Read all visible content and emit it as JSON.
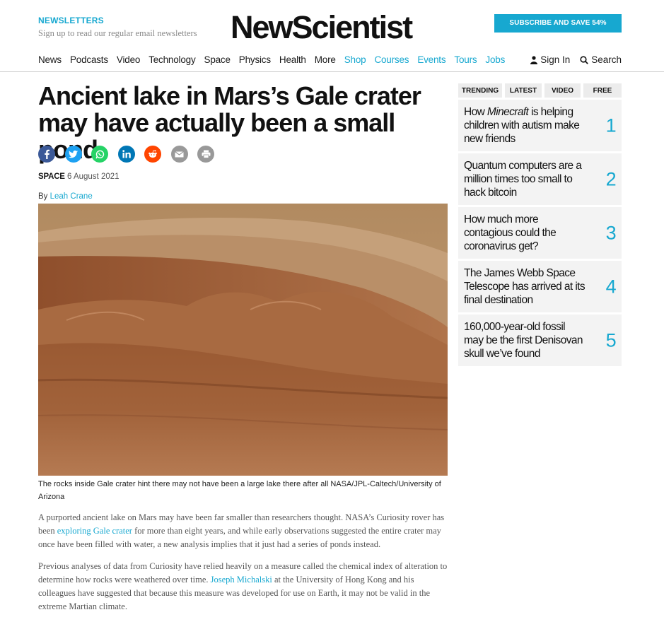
{
  "header": {
    "newsletters_title": "NEWSLETTERS",
    "newsletters_sub": "Sign up to read our regular email newsletters",
    "logo": "NewScientist",
    "subscribe": "SUBSCRIBE AND SAVE 54%"
  },
  "nav": {
    "items": [
      "News",
      "Podcasts",
      "Video",
      "Technology",
      "Space",
      "Physics",
      "Health",
      "More",
      "Shop",
      "Courses",
      "Events",
      "Tours",
      "Jobs"
    ],
    "sign_in": "Sign In",
    "search": "Search"
  },
  "article": {
    "headline": "Ancient lake in Mars’s Gale crater may have actually been a small pond",
    "section": "SPACE",
    "date": "6 August 2021",
    "by": "By",
    "author": "Leah Crane",
    "caption": "The rocks inside Gale crater hint there may not have been a large lake there after all NASA/JPL-Caltech/University of Arizona",
    "p1_a": "A purported ancient lake on Mars may have been far smaller than researchers thought. NASA’s Curiosity rover has been ",
    "p1_link": "exploring Gale crater",
    "p1_b": " for more than eight years, and while early observations suggested the entire crater may once have been filled with water, a new analysis implies that it just had a series of ponds instead.",
    "p2_a": "Previous analyses of data from Curiosity have relied heavily on a measure called the chemical index of alteration to determine how rocks were weathered over time. ",
    "p2_link": "Joseph Michalski",
    "p2_b": " at the University of Hong Kong and his colleagues have suggested that because this measure was developed for use on Earth, it may not be valid in the extreme Martian climate."
  },
  "sidebar": {
    "tabs": [
      "TRENDING",
      "LATEST",
      "VIDEO",
      "FREE"
    ],
    "trending": [
      {
        "pre": "How ",
        "em": "Minecraft",
        "post": " is helping children with autism make new friends",
        "num": "1"
      },
      {
        "pre": "Quantum computers are a million times too small to hack bitcoin",
        "em": "",
        "post": "",
        "num": "2"
      },
      {
        "pre": "How much more contagious could the coronavirus get?",
        "em": "",
        "post": "",
        "num": "3"
      },
      {
        "pre": "The James Webb Space Telescope has arrived at its final destination",
        "em": "",
        "post": "",
        "num": "4"
      },
      {
        "pre": "160,000-year-old fossil may be the first Denisovan skull we’ve found",
        "em": "",
        "post": "",
        "num": "5"
      }
    ]
  },
  "share_icons": [
    "facebook-icon",
    "twitter-icon",
    "whatsapp-icon",
    "linkedin-icon",
    "reddit-icon",
    "email-icon",
    "print-icon"
  ],
  "colors": {
    "accent": "#17a8d0",
    "facebook": "#3b5998",
    "twitter": "#1da1f2",
    "whatsapp": "#25d366",
    "linkedin": "#0077b5",
    "reddit": "#ff4500",
    "grey": "#999999"
  }
}
